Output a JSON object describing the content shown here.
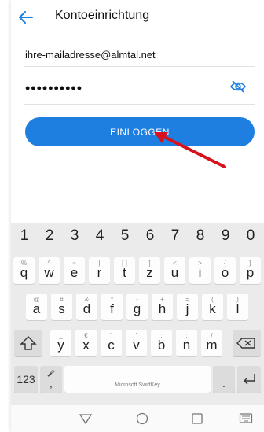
{
  "header": {
    "title": "Kontoeinrichtung"
  },
  "form": {
    "email_value": "ihre-mailadresse@almtal.net",
    "password_mask": "••••••••••",
    "login_label": "EINLOGGEN"
  },
  "keyboard": {
    "numbers": [
      "1",
      "2",
      "3",
      "4",
      "5",
      "6",
      "7",
      "8",
      "9",
      "0"
    ],
    "row1": [
      {
        "k": "q",
        "a": "%"
      },
      {
        "k": "w",
        "a": "^"
      },
      {
        "k": "e",
        "a": "~"
      },
      {
        "k": "r",
        "a": "|"
      },
      {
        "k": "t",
        "a": "[ ]"
      },
      {
        "k": "z",
        "a": "]"
      },
      {
        "k": "u",
        "a": "<"
      },
      {
        "k": "i",
        "a": ">"
      },
      {
        "k": "o",
        "a": "{"
      },
      {
        "k": "p",
        "a": "}"
      }
    ],
    "row2": [
      {
        "k": "a",
        "a": "@"
      },
      {
        "k": "s",
        "a": "#"
      },
      {
        "k": "d",
        "a": "&"
      },
      {
        "k": "f",
        "a": "*"
      },
      {
        "k": "g",
        "a": "-"
      },
      {
        "k": "h",
        "a": "+"
      },
      {
        "k": "j",
        "a": "="
      },
      {
        "k": "k",
        "a": "("
      },
      {
        "k": "l",
        "a": ")"
      }
    ],
    "row3": [
      {
        "k": "y",
        "a": "_"
      },
      {
        "k": "x",
        "a": "€"
      },
      {
        "k": "c",
        "a": "\""
      },
      {
        "k": "v",
        "a": "'"
      },
      {
        "k": "b",
        "a": ":"
      },
      {
        "k": "n",
        "a": ";"
      },
      {
        "k": "m",
        "a": "/"
      }
    ],
    "numeric_toggle": "123",
    "comma": ",",
    "period": ".",
    "space_label": "Microsoft SwiftKey"
  },
  "colors": {
    "accent": "#1e7fe0",
    "annotation_arrow": "#d8121c"
  }
}
